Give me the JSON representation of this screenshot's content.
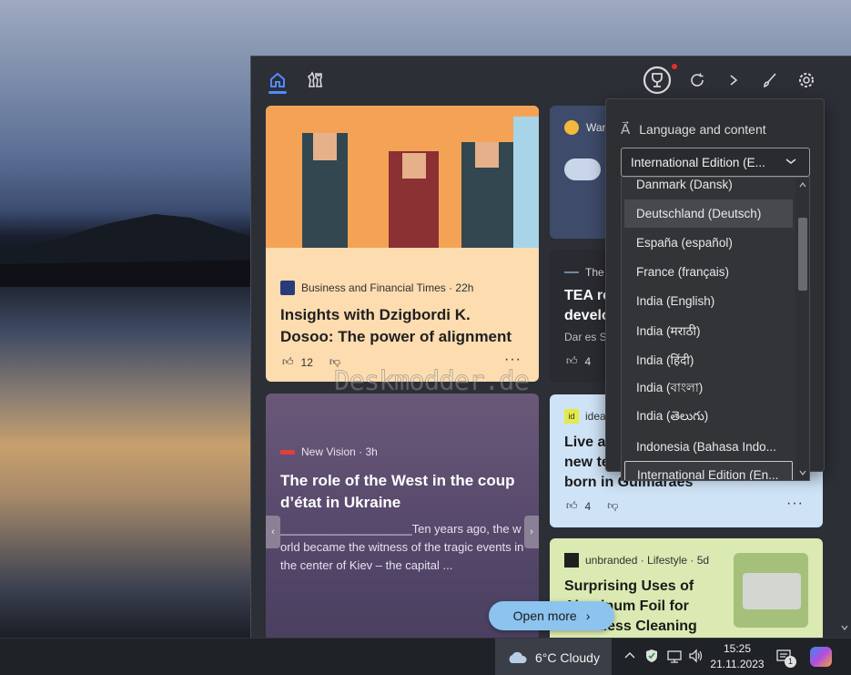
{
  "watermark": "Deskmodder.de",
  "top_nav": {
    "home_icon": "home-icon",
    "games_icon": "chess-icon",
    "rewards_icon": "trophy-icon",
    "refresh_icon": "refresh-icon",
    "next_icon": "chevron-right-icon",
    "personalize_icon": "brush-icon",
    "settings_icon": "gear-icon",
    "accent_color": "#4f8bff",
    "notification_dot_color": "#e03030"
  },
  "cards": {
    "business": {
      "source": "Business and Financial Times · 22h",
      "title": "Insights with Dzigbordi K. Dosoo: The power of alignment",
      "likes": "12",
      "background": "#fddcb0"
    },
    "newvision": {
      "source": "New Vision · 3h",
      "title": "The role of the West in the coup d’état in Ukraine",
      "snippet": "____________________Ten years ago, the world became the witness of the tragic events in the center of Kiev – the capital ..."
    },
    "weather": {
      "label": "War"
    },
    "tea": {
      "source": "The",
      "title_line1": "TEA re",
      "title_line2": "develo",
      "meta": "Dar es Sa",
      "likes": "4"
    },
    "ideas": {
      "source": "idea",
      "title_line1": "Live ar",
      "title_line2": "new te",
      "title_line3": "born in Guimarães",
      "likes": "4",
      "background": "#cfe3f7"
    },
    "unbranded": {
      "source": "unbranded · Lifestyle · 5d",
      "title": "Surprising Uses of Aluminum Foil for Effortless Cleaning",
      "background": "#dbeab2"
    }
  },
  "open_more": "Open more",
  "language_panel": {
    "header": "Language and content",
    "selected": "International Edition (E...",
    "options": [
      "Danmark (Dansk)",
      "Deutschland (Deutsch)",
      "España (español)",
      "France (français)",
      "India (English)",
      "India (मराठी)",
      "India (हिंदी)",
      "India (বাংলা)",
      "India (తెలుగు)",
      "Indonesia (Bahasa Indo...",
      "International Edition (En..."
    ],
    "hover_index": 1,
    "selected_index": 10
  },
  "taskbar": {
    "weather": "6°C  Cloudy",
    "time": "15:25",
    "date": "21.11.2023",
    "notification_count": "1",
    "icons": [
      "cloud-icon",
      "chevron-up-icon",
      "shield-icon",
      "network-icon",
      "volume-icon",
      "notification-icon",
      "copilot-icon"
    ]
  }
}
